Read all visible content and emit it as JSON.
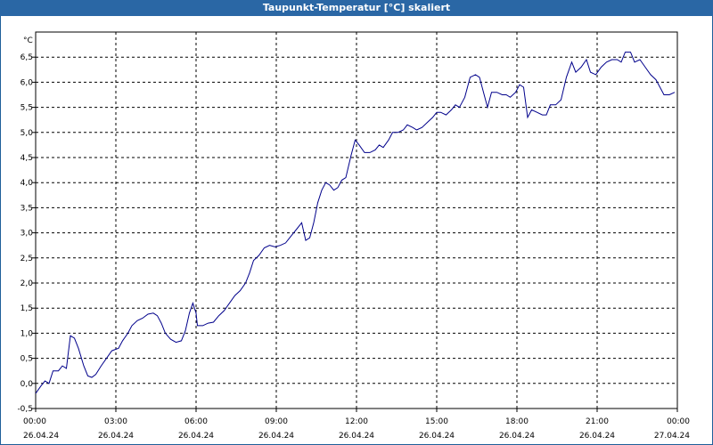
{
  "window": {
    "title": "Taupunkt-Temperatur [°C] skaliert"
  },
  "colors": {
    "titlebar": "#2a67a5",
    "line": "#00008b",
    "grid": "#000000"
  },
  "chart_data": {
    "type": "line",
    "title": "Taupunkt-Temperatur [°C] skaliert",
    "unit_label": "°C",
    "xlabel": "",
    "ylabel": "",
    "ylim": [
      -0.5,
      7.0
    ],
    "xlim_hours": [
      0,
      24
    ],
    "grid": true,
    "yticks": [
      "-0,5",
      "0,0",
      "0,5",
      "1,0",
      "1,5",
      "2,0",
      "2,5",
      "3,0",
      "3,5",
      "4,0",
      "4,5",
      "5,0",
      "5,5",
      "6,0",
      "6,5"
    ],
    "xticks": [
      {
        "time": "00:00",
        "date": "26.04.24"
      },
      {
        "time": "03:00",
        "date": "26.04.24"
      },
      {
        "time": "06:00",
        "date": "26.04.24"
      },
      {
        "time": "09:00",
        "date": "26.04.24"
      },
      {
        "time": "12:00",
        "date": "26.04.24"
      },
      {
        "time": "15:00",
        "date": "26.04.24"
      },
      {
        "time": "18:00",
        "date": "26.04.24"
      },
      {
        "time": "21:00",
        "date": "26.04.24"
      },
      {
        "time": "00:00",
        "date": "27.04.24"
      }
    ],
    "series": [
      {
        "points": [
          [
            0.0,
            -0.2
          ],
          [
            0.2,
            -0.05
          ],
          [
            0.35,
            0.05
          ],
          [
            0.5,
            0.0
          ],
          [
            0.65,
            0.25
          ],
          [
            0.85,
            0.25
          ],
          [
            1.0,
            0.35
          ],
          [
            1.15,
            0.3
          ],
          [
            1.3,
            0.95
          ],
          [
            1.45,
            0.9
          ],
          [
            1.6,
            0.7
          ],
          [
            1.8,
            0.35
          ],
          [
            1.95,
            0.15
          ],
          [
            2.1,
            0.12
          ],
          [
            2.25,
            0.18
          ],
          [
            2.45,
            0.35
          ],
          [
            2.65,
            0.5
          ],
          [
            2.85,
            0.65
          ],
          [
            3.0,
            0.68
          ],
          [
            3.1,
            0.7
          ],
          [
            3.25,
            0.85
          ],
          [
            3.45,
            1.0
          ],
          [
            3.6,
            1.15
          ],
          [
            3.8,
            1.25
          ],
          [
            4.0,
            1.3
          ],
          [
            4.2,
            1.38
          ],
          [
            4.4,
            1.4
          ],
          [
            4.55,
            1.35
          ],
          [
            4.7,
            1.2
          ],
          [
            4.85,
            1.0
          ],
          [
            5.05,
            0.88
          ],
          [
            5.25,
            0.82
          ],
          [
            5.45,
            0.85
          ],
          [
            5.6,
            1.05
          ],
          [
            5.75,
            1.4
          ],
          [
            5.88,
            1.6
          ],
          [
            6.0,
            1.4
          ],
          [
            6.05,
            1.15
          ],
          [
            6.25,
            1.15
          ],
          [
            6.45,
            1.2
          ],
          [
            6.65,
            1.22
          ],
          [
            6.85,
            1.35
          ],
          [
            7.05,
            1.45
          ],
          [
            7.25,
            1.6
          ],
          [
            7.45,
            1.75
          ],
          [
            7.65,
            1.85
          ],
          [
            7.85,
            2.0
          ],
          [
            8.0,
            2.2
          ],
          [
            8.15,
            2.45
          ],
          [
            8.35,
            2.55
          ],
          [
            8.55,
            2.7
          ],
          [
            8.75,
            2.75
          ],
          [
            8.95,
            2.72
          ],
          [
            9.15,
            2.75
          ],
          [
            9.35,
            2.8
          ],
          [
            9.5,
            2.9
          ],
          [
            9.65,
            3.0
          ],
          [
            9.8,
            3.1
          ],
          [
            9.95,
            3.2
          ],
          [
            10.1,
            2.85
          ],
          [
            10.25,
            2.9
          ],
          [
            10.4,
            3.2
          ],
          [
            10.55,
            3.6
          ],
          [
            10.7,
            3.85
          ],
          [
            10.85,
            4.0
          ],
          [
            11.0,
            3.95
          ],
          [
            11.15,
            3.85
          ],
          [
            11.3,
            3.9
          ],
          [
            11.45,
            4.05
          ],
          [
            11.6,
            4.1
          ],
          [
            11.8,
            4.55
          ],
          [
            11.95,
            4.85
          ],
          [
            12.1,
            4.75
          ],
          [
            12.3,
            4.6
          ],
          [
            12.5,
            4.6
          ],
          [
            12.7,
            4.65
          ],
          [
            12.85,
            4.75
          ],
          [
            13.0,
            4.7
          ],
          [
            13.2,
            4.85
          ],
          [
            13.35,
            5.0
          ],
          [
            13.55,
            5.0
          ],
          [
            13.75,
            5.05
          ],
          [
            13.9,
            5.15
          ],
          [
            14.1,
            5.1
          ],
          [
            14.25,
            5.05
          ],
          [
            14.45,
            5.1
          ],
          [
            14.65,
            5.2
          ],
          [
            14.85,
            5.3
          ],
          [
            15.0,
            5.4
          ],
          [
            15.15,
            5.4
          ],
          [
            15.35,
            5.35
          ],
          [
            15.55,
            5.45
          ],
          [
            15.7,
            5.55
          ],
          [
            15.85,
            5.5
          ],
          [
            16.05,
            5.7
          ],
          [
            16.25,
            6.1
          ],
          [
            16.45,
            6.15
          ],
          [
            16.6,
            6.1
          ],
          [
            16.75,
            5.8
          ],
          [
            16.9,
            5.5
          ],
          [
            17.05,
            5.8
          ],
          [
            17.25,
            5.8
          ],
          [
            17.45,
            5.75
          ],
          [
            17.6,
            5.75
          ],
          [
            17.75,
            5.7
          ],
          [
            17.95,
            5.8
          ],
          [
            18.1,
            5.95
          ],
          [
            18.25,
            5.9
          ],
          [
            18.4,
            5.3
          ],
          [
            18.55,
            5.45
          ],
          [
            18.75,
            5.4
          ],
          [
            18.95,
            5.35
          ],
          [
            19.1,
            5.35
          ],
          [
            19.25,
            5.55
          ],
          [
            19.45,
            5.55
          ],
          [
            19.65,
            5.65
          ],
          [
            19.85,
            6.1
          ],
          [
            20.05,
            6.4
          ],
          [
            20.2,
            6.2
          ],
          [
            20.4,
            6.3
          ],
          [
            20.6,
            6.45
          ],
          [
            20.75,
            6.2
          ],
          [
            20.95,
            6.15
          ],
          [
            21.15,
            6.3
          ],
          [
            21.35,
            6.4
          ],
          [
            21.55,
            6.45
          ],
          [
            21.75,
            6.45
          ],
          [
            21.9,
            6.4
          ],
          [
            22.05,
            6.6
          ],
          [
            22.25,
            6.6
          ],
          [
            22.4,
            6.4
          ],
          [
            22.6,
            6.45
          ],
          [
            22.8,
            6.3
          ],
          [
            23.0,
            6.15
          ],
          [
            23.2,
            6.05
          ],
          [
            23.35,
            5.9
          ],
          [
            23.5,
            5.75
          ],
          [
            23.7,
            5.75
          ],
          [
            23.9,
            5.8
          ]
        ]
      }
    ]
  }
}
